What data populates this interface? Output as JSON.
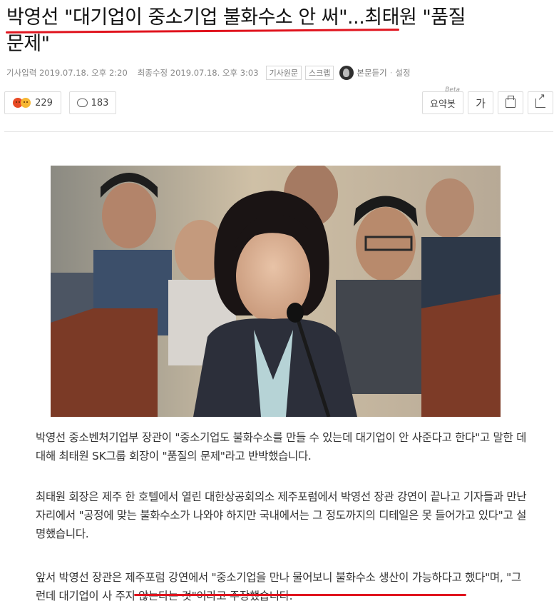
{
  "article": {
    "headline_line1": "박영선 \"대기업이 중소기업 불화수소 안 써\"...최태원 \"품질",
    "headline_line2": "문제\"",
    "meta": {
      "input_label": "기사입력",
      "input_time": "2019.07.18. 오후 2:20",
      "modified_label": "최종수정",
      "modified_time": "2019.07.18. 오후 3:03",
      "original_button": "기사원문",
      "scrap_button": "스크랩",
      "listen_button": "본문듣기",
      "settings_link": "설정"
    },
    "toolbar": {
      "reaction_count": "229",
      "comment_count": "183",
      "summary_button": "요약봇",
      "summary_badge": "Beta",
      "font_button": "가"
    },
    "paragraphs": [
      "박영선 중소벤처기업부 장관이 \"중소기업도 불화수소를 만들 수 있는데 대기업이 안 사준다고 한다\"고 말한 데 대해 최태원 SK그룹 회장이 \"품질의 문제\"라고 반박했습니다.",
      "최태원 회장은 제주 한 호텔에서 열린 대한상공회의소 제주포럼에서 박영선 장관 강연이 끝나고 기자들과 만난 자리에서 \"공정에 맞는 불화수소가 나와야 하지만 국내에서는 그 정도까지의 디테일은 못 들어가고 있다\"고 설명했습니다.",
      "앞서 박영선 장관은 제주포럼 강연에서 \"중소기업을 만나 물어보니 불화수소 생산이 가능하다고 했다\"며, \"그런데 대기업이 사 주지 않는다는 것\"이라고 주장했습니다."
    ]
  },
  "icons": {
    "reaction": "angry-sad-emoji-icon",
    "comment": "speech-bubble-icon",
    "print": "printer-icon",
    "share": "share-icon",
    "listen": "speaker-avatar-icon"
  },
  "colors": {
    "underline": "#e0141e",
    "text": "#333333",
    "meta": "#888888"
  }
}
